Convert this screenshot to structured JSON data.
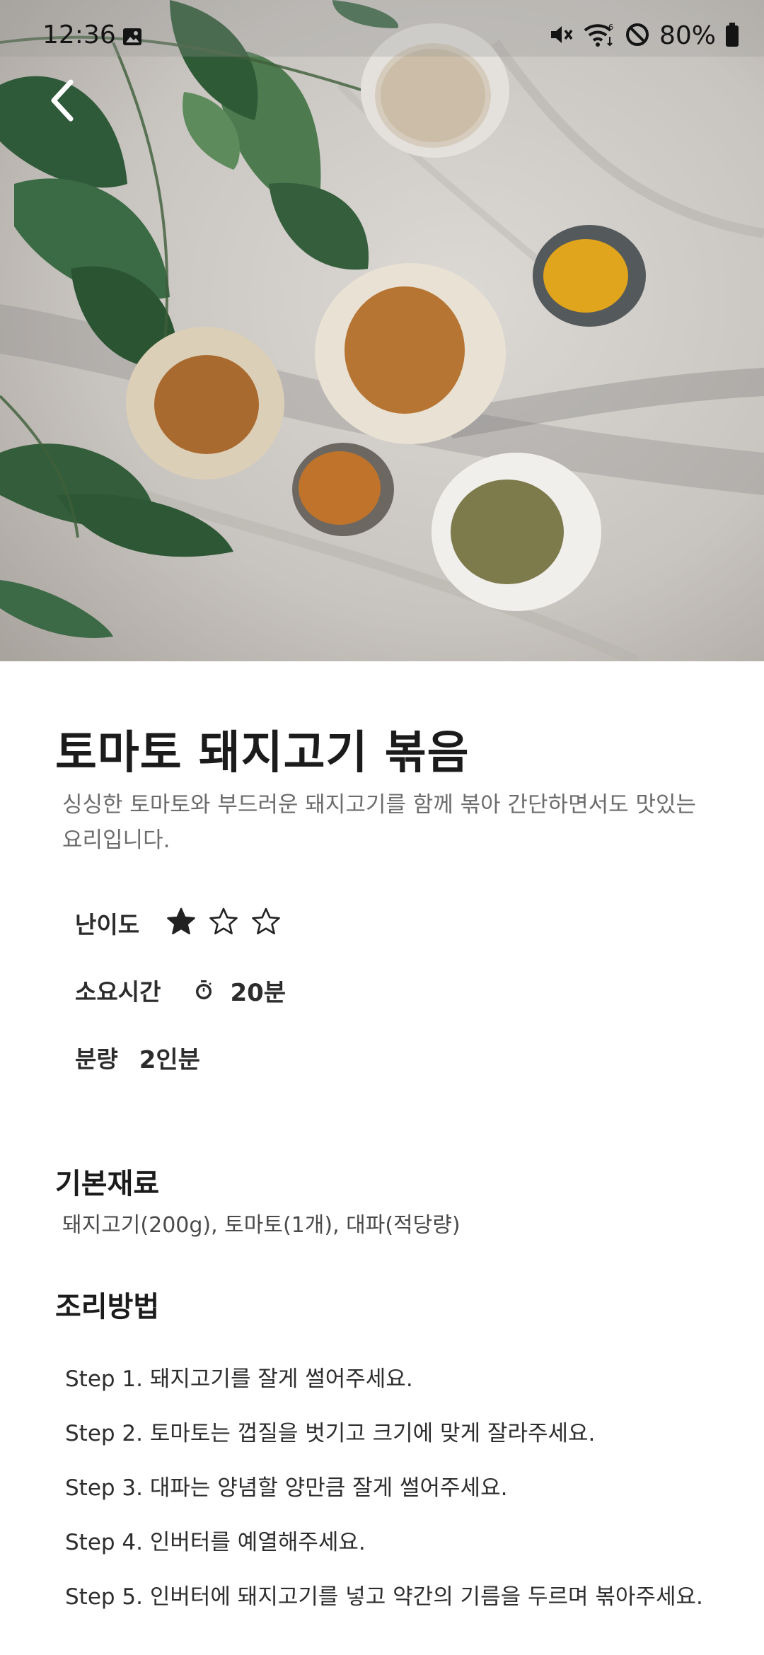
{
  "status_bar": {
    "time": "12:36",
    "battery": "80%",
    "icons": [
      "gallery-icon",
      "mute-icon",
      "wifi-icon",
      "do-not-disturb-icon",
      "battery-icon"
    ]
  },
  "nav": {
    "back_icon": "chevron-left-icon"
  },
  "recipe": {
    "title": "토마토 돼지고기 볶음",
    "description": "싱싱한 토마토와 부드러운 돼지고기를 함께 볶아 간단하면서도 맛있는 요리입니다.",
    "difficulty": {
      "label": "난이도",
      "rating": 1,
      "max": 3
    },
    "time": {
      "label": "소요시간",
      "value": "20분",
      "icon": "stopwatch-icon"
    },
    "serving": {
      "label": "분량",
      "value": "2인분"
    }
  },
  "ingredients": {
    "title": "기본재료",
    "text": "돼지고기(200g), 토마토(1개), 대파(적당량)"
  },
  "method": {
    "title": "조리방법",
    "steps": [
      "Step 1. 돼지고기를 잘게 썰어주세요.",
      "Step 2. 토마토는 껍질을 벗기고 크기에 맞게 잘라주세요.",
      "Step 3. 대파는 양념할 양만큼 잘게 썰어주세요.",
      "Step 4. 인버터를 예열해주세요.",
      "Step 5. 인버터에 돼지고기를 넣고 약간의 기름을 두르며 볶아주세요."
    ]
  },
  "colors": {
    "star": "#222222",
    "title": "#1b1b1b",
    "secondary_text": "#6c6c6c"
  }
}
